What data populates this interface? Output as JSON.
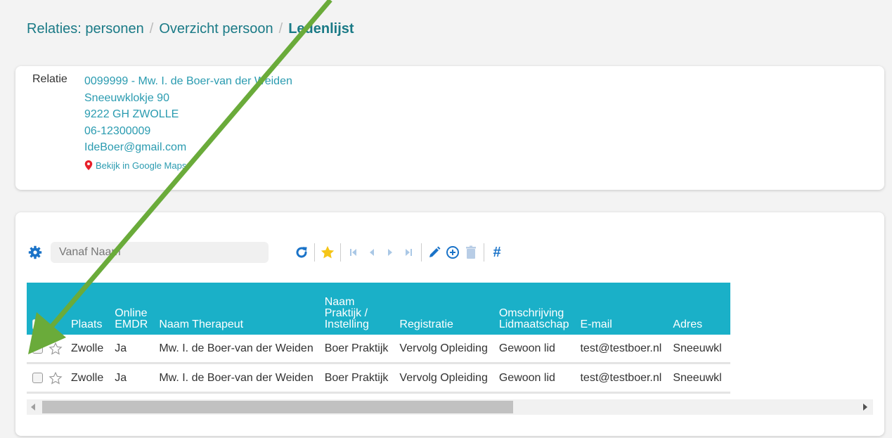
{
  "breadcrumb": {
    "items": [
      "Relaties: personen",
      "Overzicht persoon"
    ],
    "current": "Ledenlijst",
    "separator": "/"
  },
  "relation": {
    "label": "Relatie",
    "lines": [
      "0099999 - Mw. I. de Boer-van der Weiden",
      "Sneeuwklokje 90",
      "9222 GH ZWOLLE",
      "06-12300009",
      "IdeBoer@gmail.com"
    ],
    "maps_link": "Bekijk in Google Maps"
  },
  "toolbar": {
    "search_placeholder": "Vanaf Naam",
    "search_value": "",
    "hash_label": "#",
    "icons": [
      "gear-icon",
      "refresh-icon",
      "favorite-star-icon",
      "first-page-icon",
      "previous-icon",
      "next-icon",
      "last-page-icon",
      "edit-icon",
      "add-icon",
      "delete-icon",
      "hash-icon"
    ]
  },
  "table": {
    "columns": [
      "Plaats",
      "Online\nEMDR",
      "Naam Therapeut",
      "Naam\nPraktijk /\nInstelling",
      "Registratie",
      "Omschrijving\nLidmaatschap",
      "E-mail",
      "Adres"
    ],
    "rows": [
      [
        "Zwolle",
        "Ja",
        "Mw. I. de Boer-van der Weiden",
        "Boer Praktijk",
        "Vervolg Opleiding",
        "Gewoon lid",
        "test@testboer.nl",
        "Sneeuwkl"
      ],
      [
        "Zwolle",
        "Ja",
        "Mw. I. de Boer-van der Weiden",
        "Boer Praktijk",
        "Vervolg Opleiding",
        "Gewoon lid",
        "test@testboer.nl",
        "Sneeuwkl"
      ]
    ]
  },
  "colors": {
    "accent": "#1ab0c8",
    "link": "#2a9bb0",
    "star": "#f5c518",
    "toolbar_blue": "#1a73c8",
    "annotation_arrow": "#6aab3a"
  }
}
